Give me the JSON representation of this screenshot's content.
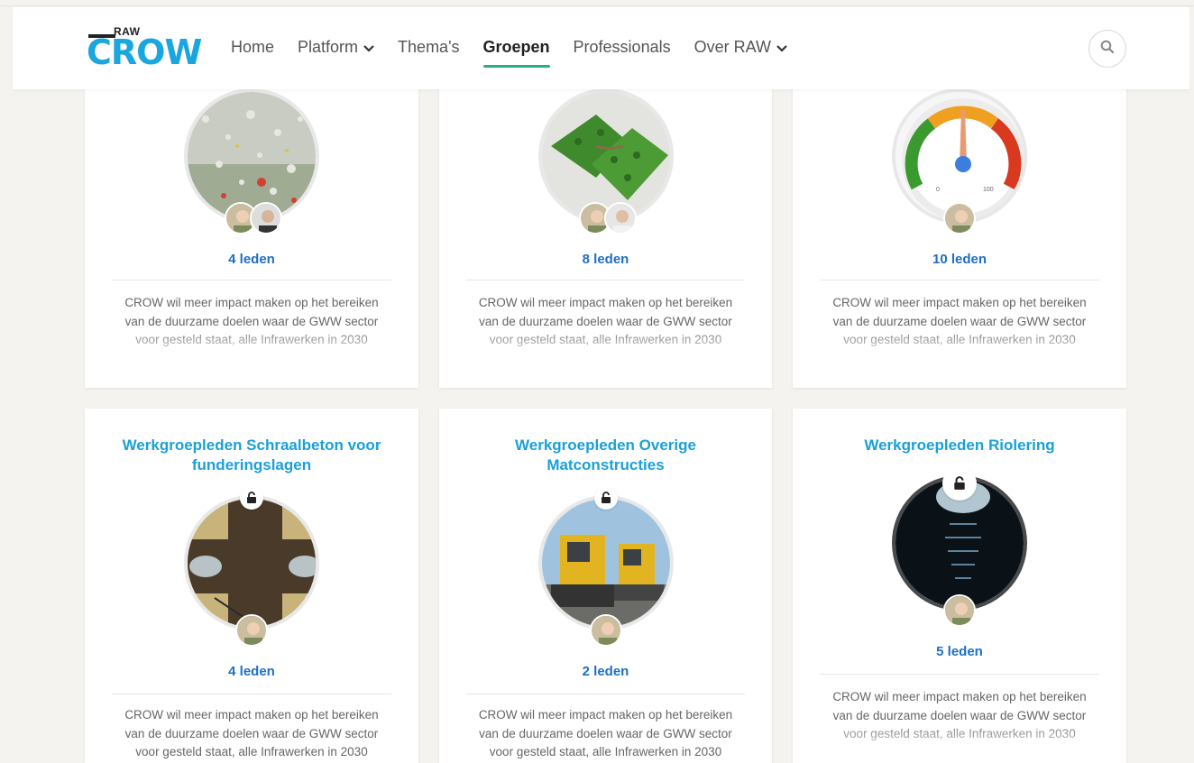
{
  "header": {
    "logo_super": "RAW",
    "logo_text": "CROW",
    "nav": [
      {
        "label": "Home"
      },
      {
        "label": "Platform"
      },
      {
        "label": "Thema's"
      },
      {
        "label": "Groepen"
      },
      {
        "label": "Professionals"
      },
      {
        "label": "Over RAW"
      }
    ],
    "active_nav": "Groepen",
    "search_icon": "search-icon"
  },
  "description": {
    "line1": "CROW wil meer impact maken op het bereiken",
    "line2": "van de duurzame doelen waar de GWW sector",
    "line3": "voor gesteld staat, alle Infrawerken in 2030"
  },
  "groups": [
    {
      "title": "",
      "members_label": "4 leden",
      "image": "wildflower-meadow",
      "members": 2
    },
    {
      "title": "",
      "members_label": "8 leden",
      "image": "green-handshake",
      "members": 2
    },
    {
      "title": "",
      "members_label": "10 leden",
      "image": "speedometer-gauge",
      "members": 1
    },
    {
      "title": "Werkgroepleden Schraalbeton voor funderingslagen",
      "members_label": "4 leden",
      "image": "road-aerial",
      "members": 1
    },
    {
      "title": "Werkgroepleden Overige Matconstructies",
      "members_label": "2 leden",
      "image": "yellow-excavators",
      "members": 1
    },
    {
      "title": "Werkgroepleden Riolering",
      "members_label": "5 leden",
      "image": "sewer-tunnel",
      "members": 1
    }
  ],
  "gauge": {
    "min_label": "0",
    "max_label": "100"
  },
  "colors": {
    "accent": "#1aa0d8",
    "count": "#1e6fc4",
    "active_underline": "#25b07f"
  }
}
